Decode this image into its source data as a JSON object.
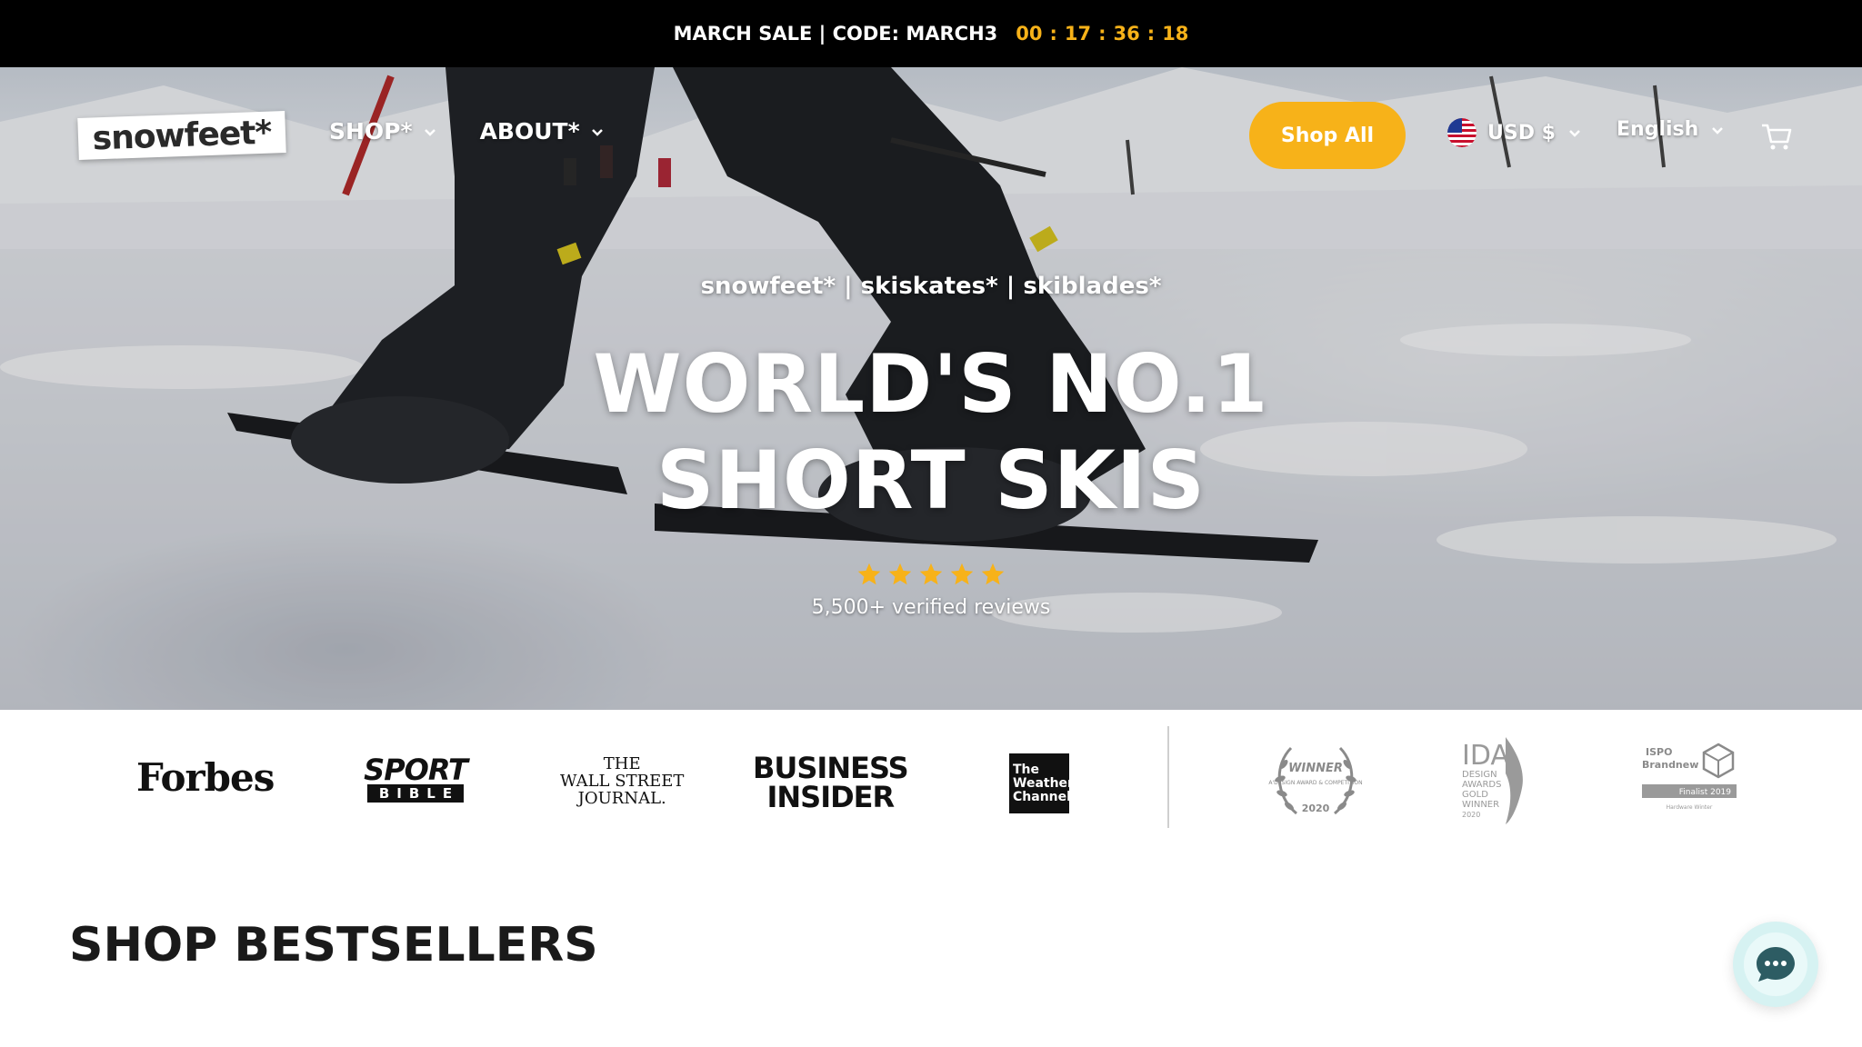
{
  "announcement": {
    "text": "MARCH SALE | CODE: MARCH3",
    "countdown": [
      "00",
      "17",
      "36",
      "18"
    ],
    "separator": ":"
  },
  "header": {
    "logo": "snowfeet*",
    "nav": [
      {
        "label": "SHOP*"
      },
      {
        "label": "ABOUT*"
      }
    ],
    "shop_all_label": "Shop All",
    "currency": "USD $",
    "language": "English"
  },
  "hero": {
    "tagline": "snowfeet* | skiskates* | skiblades*",
    "headline_line1": "WORLD'S NO.1",
    "headline_line2": "SHORT SKIS",
    "rating_stars": 5,
    "reviews": "5,500+ verified reviews"
  },
  "press": {
    "forbes": "Forbes",
    "sport_bible_top": "SPORT",
    "sport_bible_bottom": "BIBLE",
    "wsj_line1": "THE",
    "wsj_line2": "WALL STREET",
    "wsj_line3": "JOURNAL.",
    "business_insider_line1": "BUSINESS",
    "business_insider_line2": "INSIDER",
    "weather_line1": "The",
    "weather_line2": "Weather",
    "weather_line3": "Channel",
    "award_winner_title": "WINNER",
    "award_winner_sub": "A'DESIGN AWARD & COMPETITION",
    "award_winner_year": "2020",
    "award_ida_title": "IDA",
    "award_ida_lines": [
      "DESIGN",
      "AWARDS",
      "GOLD",
      "WINNER",
      "2020"
    ],
    "award_ispo_title": "ISPO",
    "award_ispo_brand": "Brandnew",
    "award_ispo_finalist": "Finalist 2019",
    "award_ispo_sub": "Hardware Winter"
  },
  "main": {
    "section_title": "SHOP BESTSELLERS"
  },
  "colors": {
    "accent": "#f7b219",
    "topbar": "#000000",
    "chat_bubble": "#2d5c63"
  },
  "icons": [
    "chevron-down-icon",
    "us-flag-icon",
    "cart-icon",
    "star-icon",
    "chat-icon"
  ]
}
